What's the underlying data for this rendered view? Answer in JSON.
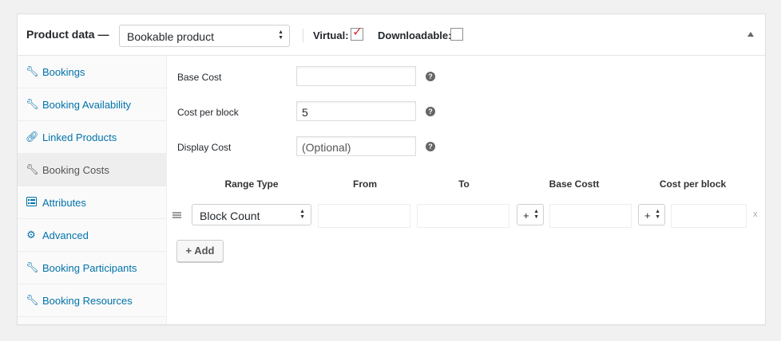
{
  "header": {
    "title": "Product data —",
    "product_type": "Bookable product",
    "virtual_label": "Virtual:",
    "virtual_checked": true,
    "downloadable_label": "Downloadable:",
    "downloadable_checked": false
  },
  "sidebar": {
    "items": [
      {
        "label": "Bookings",
        "icon": "wrench-icon",
        "active": false
      },
      {
        "label": "Booking Availability",
        "icon": "wrench-icon",
        "active": false
      },
      {
        "label": "Linked Products",
        "icon": "link-icon",
        "active": false
      },
      {
        "label": "Booking Costs",
        "icon": "wrench-icon",
        "active": true
      },
      {
        "label": "Attributes",
        "icon": "attributes-icon",
        "active": false
      },
      {
        "label": "Advanced",
        "icon": "gear-icon",
        "active": false
      },
      {
        "label": "Booking Participants",
        "icon": "wrench-icon",
        "active": false
      },
      {
        "label": "Booking Resources",
        "icon": "wrench-icon",
        "active": false
      }
    ]
  },
  "fields": {
    "base_cost": {
      "label": "Base Cost",
      "value": ""
    },
    "cost_per_block": {
      "label": "Cost per block",
      "value": "5"
    },
    "display_cost": {
      "label": "Display Cost",
      "placeholder": "(Optional)"
    }
  },
  "table": {
    "headers": [
      "Range Type",
      "From",
      "To",
      "Base Costt",
      "Cost per block"
    ],
    "row": {
      "range_type": "Block Count",
      "base_modifier": "+",
      "block_modifier": "+",
      "remove": "x"
    },
    "add_label": "+ Add"
  },
  "colors": {
    "link": "#0073aa",
    "check": "#d63638"
  }
}
